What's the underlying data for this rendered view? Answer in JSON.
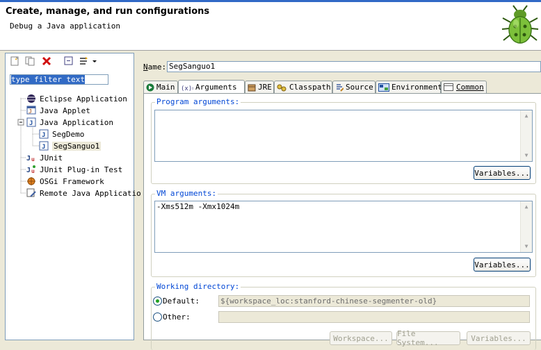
{
  "header": {
    "title": "Create, manage, and run configurations",
    "subtitle": "Debug a Java application"
  },
  "left": {
    "filter_text": "type filter text",
    "tree": [
      {
        "label": "Eclipse Application",
        "icon": "eclipse-icon"
      },
      {
        "label": "Java Applet",
        "icon": "applet-icon"
      },
      {
        "label": "Java Application",
        "icon": "java-app-icon",
        "expanded": true
      },
      {
        "label": "SegDemo",
        "icon": "java-file-icon"
      },
      {
        "label": "SegSanguo1",
        "icon": "java-file-icon",
        "selected": true
      },
      {
        "label": "JUnit",
        "icon": "junit-icon"
      },
      {
        "label": "JUnit Plug-in Test",
        "icon": "junit-plugin-icon"
      },
      {
        "label": "OSGi Framework",
        "icon": "osgi-icon"
      },
      {
        "label": "Remote Java Applicatio",
        "icon": "remote-java-icon"
      }
    ]
  },
  "main": {
    "name_label": "Name:",
    "name_value": "SegSanguo1",
    "tabs": [
      {
        "label": "Main"
      },
      {
        "label": "Arguments",
        "active": true
      },
      {
        "label": "JRE"
      },
      {
        "label": "Classpath"
      },
      {
        "label": "Source"
      },
      {
        "label": "Environment"
      },
      {
        "label": "Common"
      }
    ],
    "program_args": {
      "label": "Program arguments:",
      "value": "",
      "variables_label": "Variables..."
    },
    "vm_args": {
      "label": "VM arguments:",
      "value": "-Xms512m -Xmx1024m",
      "variables_label": "Variables..."
    },
    "working_dir": {
      "label": "Working directory:",
      "default_label": "Default:",
      "default_value": "${workspace_loc:stanford-chinese-segmenter-old}",
      "other_label": "Other:",
      "other_value": "",
      "workspace_label": "Workspace...",
      "filesystem_label": "File System...",
      "variables_label": "Variables..."
    }
  },
  "colors": {
    "accent": "#316ac5",
    "group_label": "#0046d5"
  }
}
